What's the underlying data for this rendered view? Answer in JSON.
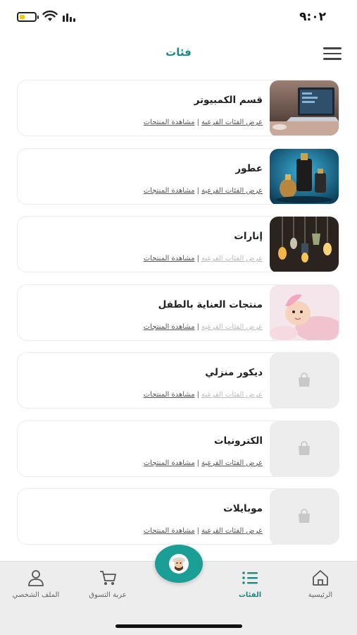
{
  "status_bar": {
    "time": "٩:٠٢",
    "battery_level": 0.35,
    "battery_color": "#f5c518"
  },
  "header": {
    "title": "فئات",
    "accent_color": "#1a8a86"
  },
  "categories": [
    {
      "name": "قسم الكمبيوتر",
      "subcategories_link": "عرض الفئات الفرعية",
      "products_link": "مشاهدة المنتجات",
      "subcategories_dim": false,
      "thumb": "computer-laptop-image"
    },
    {
      "name": "عطور",
      "subcategories_link": "عرض الفئات الفرعية",
      "products_link": "مشاهدة المنتجات",
      "subcategories_dim": false,
      "thumb": "perfume-bottles-image"
    },
    {
      "name": "إنارات",
      "subcategories_link": "عرض الفئات الفرعية",
      "products_link": "مشاهدة المنتجات",
      "subcategories_dim": true,
      "thumb": "pendant-lamps-image"
    },
    {
      "name": "منتجات العناية بالطفل",
      "subcategories_link": "عرض الفئات الفرعية",
      "products_link": "مشاهدة المنتجات",
      "subcategories_dim": true,
      "thumb": "baby-photo-image"
    },
    {
      "name": "ديكور منزلي",
      "subcategories_link": "عرض الفئات الفرعية",
      "products_link": "مشاهدة المنتجات",
      "subcategories_dim": true,
      "thumb": "placeholder-bag-icon"
    },
    {
      "name": "الكترونيات",
      "subcategories_link": "عرض الفئات الفرعية",
      "products_link": "مشاهدة المنتجات",
      "subcategories_dim": false,
      "thumb": "placeholder-bag-icon"
    },
    {
      "name": "موبايلات",
      "subcategories_link": "عرض الفئات الفرعية",
      "products_link": "مشاهدة المنتجات",
      "subcategories_dim": false,
      "thumb": "placeholder-bag-icon"
    }
  ],
  "bottom_nav": {
    "profile": {
      "label": "الملف الشخصي",
      "icon": "person-icon"
    },
    "cart": {
      "label": "عربة التسوق",
      "icon": "cart-icon"
    },
    "categories": {
      "label": "الفئات",
      "icon": "list-icon",
      "active": true
    },
    "home": {
      "label": "الرئيسية",
      "icon": "home-icon"
    },
    "center": {
      "icon": "avatar-logo-icon",
      "color": "#1a9e96"
    }
  }
}
